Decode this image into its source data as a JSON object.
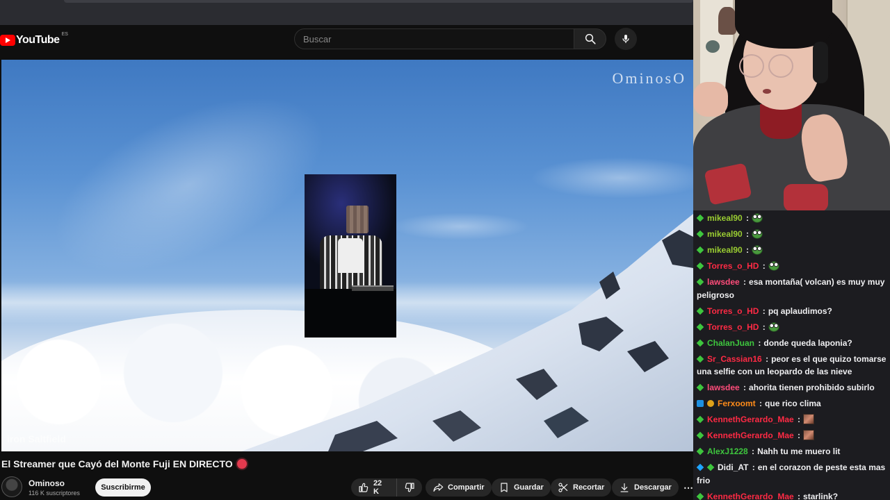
{
  "youtube": {
    "logo_text": "YouTube",
    "region": "ES",
    "search_placeholder": "Buscar"
  },
  "video": {
    "watermark": "OminosO",
    "credit": "iron Saltfield",
    "title": "El Streamer que Cayó del Monte Fuji EN DIRECTO"
  },
  "channel": {
    "name": "Ominoso",
    "subscribers": "116 K suscriptores",
    "subscribe_label": "Suscribirme"
  },
  "actions": {
    "likes": "22 K",
    "share": "Compartir",
    "save": "Guardar",
    "clip": "Recortar",
    "download": "Descargar",
    "more": "⋯"
  },
  "chat": {
    "messages": [
      {
        "badges": [
          "diamond"
        ],
        "user": "mikeal90",
        "color": "#9acd32",
        "text": "",
        "emote": "frog"
      },
      {
        "badges": [
          "diamond"
        ],
        "user": "mikeal90",
        "color": "#9acd32",
        "text": "",
        "emote": "frog"
      },
      {
        "badges": [
          "diamond"
        ],
        "user": "mikeal90",
        "color": "#9acd32",
        "text": "",
        "emote": "frog"
      },
      {
        "badges": [
          "diamond"
        ],
        "user": "Torres_o_HD",
        "color": "#ff2a44",
        "text": "",
        "emote": "frog"
      },
      {
        "badges": [
          "diamond"
        ],
        "user": "lawsdee",
        "color": "#ff4c7a",
        "text": "esa montaña( volcan) es muy muy peligroso",
        "emote": ""
      },
      {
        "badges": [
          "diamond"
        ],
        "user": "Torres_o_HD",
        "color": "#ff2a44",
        "text": "pq aplaudimos?",
        "emote": ""
      },
      {
        "badges": [
          "diamond"
        ],
        "user": "Torres_o_HD",
        "color": "#ff2a44",
        "text": "",
        "emote": "frog"
      },
      {
        "badges": [
          "diamond"
        ],
        "user": "ChalanJuan",
        "color": "#3ec63e",
        "text": "donde queda laponia?",
        "emote": ""
      },
      {
        "badges": [
          "diamond"
        ],
        "user": "Sr_Cassian16",
        "color": "#ff2a44",
        "text": "peor es el que quizo tomarse una selfie con un leopardo de las nieve",
        "emote": ""
      },
      {
        "badges": [
          "diamond"
        ],
        "user": "lawsdee",
        "color": "#ff4c7a",
        "text": "ahorita tienen prohibido subirlo",
        "emote": ""
      },
      {
        "badges": [
          "prime",
          "coin"
        ],
        "user": "Ferxoomt",
        "color": "#ff8c1a",
        "text": "que rico clima",
        "emote": ""
      },
      {
        "badges": [
          "diamond"
        ],
        "user": "KennethGerardo_Mae",
        "color": "#ff2a44",
        "text": "",
        "emote": "img"
      },
      {
        "badges": [
          "diamond"
        ],
        "user": "KennethGerardo_Mae",
        "color": "#ff2a44",
        "text": "",
        "emote": "img"
      },
      {
        "badges": [
          "diamond"
        ],
        "user": "AlexJ1228",
        "color": "#3ec63e",
        "text": "Nahh tu me muero lit",
        "emote": ""
      },
      {
        "badges": [
          "cube",
          "diamond"
        ],
        "user": "Didi_AT",
        "color": "#efeff1",
        "text": "en el corazon de peste esta mas frio",
        "emote": ""
      },
      {
        "badges": [
          "diamond"
        ],
        "user": "KennethGerardo_Mae",
        "color": "#ff2a44",
        "text": "starlink?",
        "emote": ""
      }
    ]
  }
}
